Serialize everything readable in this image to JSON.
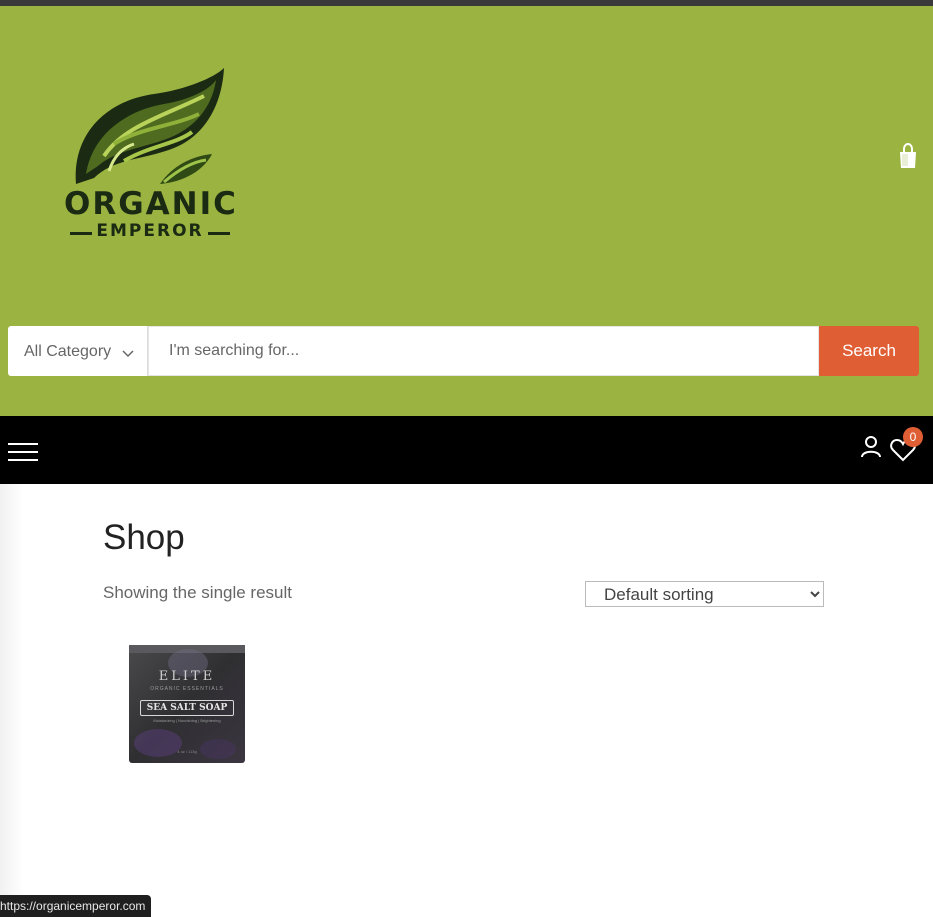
{
  "header": {
    "logo": {
      "word1": "ORGANIC",
      "word2": "EMPEROR"
    },
    "cart_icon": "shopping-bag-icon"
  },
  "search": {
    "category_label": "All Category",
    "placeholder": "I'm searching for...",
    "value": "",
    "button_label": "Search"
  },
  "nav": {
    "menu_icon": "hamburger-menu-icon",
    "account_icon": "user-icon",
    "wishlist_icon": "heart-icon",
    "wishlist_count": "0"
  },
  "shop": {
    "title": "Shop",
    "result_count": "Showing the single result",
    "sorting_selected": "Default sorting"
  },
  "products": [
    {
      "brand": "ELITE",
      "subtitle": "ORGANIC ESSENTIALS",
      "label": "SEA SALT SOAP",
      "tagline": "Moisturizing | Nourishing | Brightening",
      "weight": "4 oz / 113g"
    }
  ],
  "status_bar": {
    "url": "https://organicemperor.com"
  },
  "colors": {
    "header_bg": "#9bb340",
    "accent": "#e05e34",
    "nav_bg": "#000000",
    "logo_dark": "#1b2a12"
  }
}
